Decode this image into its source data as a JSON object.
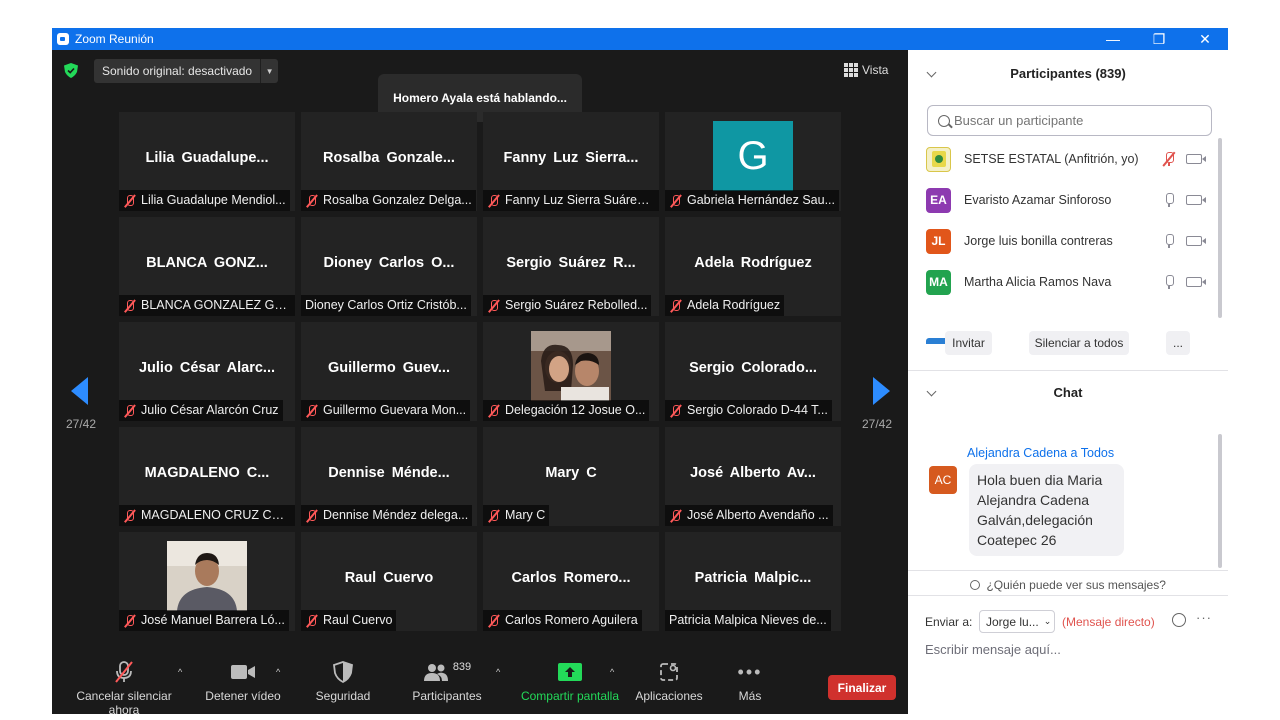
{
  "window": {
    "title": "Zoom Reunión",
    "minimize_icon": "minimize-icon",
    "restore_icon": "restore-icon",
    "close_icon": "close-icon"
  },
  "meeting": {
    "sound_label": "Sonido original: desactivado",
    "speaking_banner": "Homero Ayala está hablando...",
    "view_label": "Vista",
    "page_left": "27/42",
    "page_right": "27/42",
    "tiles": [
      {
        "big": "Lilia  Guadalupe...",
        "caption": "Lilia Guadalupe Mendiol...",
        "muted": true
      },
      {
        "big": "Rosalba  Gonzale...",
        "caption": "Rosalba Gonzalez Delga...",
        "muted": true
      },
      {
        "big": "Fanny Luz Sierra...",
        "caption": "Fanny Luz Sierra Suárez ...",
        "muted": true
      },
      {
        "big": "",
        "caption": "Gabriela Hernández Sau...",
        "muted": true,
        "avatar_letter": "G"
      },
      {
        "big": "BLANCA  GONZ...",
        "caption": "BLANCA GONZALEZ GA...",
        "muted": true
      },
      {
        "big": "Dioney Carlos  O...",
        "caption": "Dioney Carlos Ortiz Cristób...",
        "muted": false
      },
      {
        "big": "Sergio  Suárez  R...",
        "caption": "Sergio Suárez Rebolled...",
        "muted": true
      },
      {
        "big": "Adela Rodríguez",
        "caption": "Adela Rodríguez",
        "muted": true
      },
      {
        "big": "Julio César Alarc...",
        "caption": "Julio César Alarcón Cruz",
        "muted": true
      },
      {
        "big": "Guillermo  Guev...",
        "caption": "Guillermo Guevara Mon...",
        "muted": true
      },
      {
        "big": "",
        "caption": "Delegación 12 Josue O...",
        "muted": true,
        "photo": "couple"
      },
      {
        "big": "Sergio  Colorado...",
        "caption": "Sergio Colorado D-44 T...",
        "muted": true
      },
      {
        "big": "MAGDALENO C...",
        "caption": "MAGDALENO CRUZ CAS...",
        "muted": true
      },
      {
        "big": "Dennise  Ménde...",
        "caption": "Dennise Méndez delega...",
        "muted": true
      },
      {
        "big": "Mary C",
        "caption": "Mary C",
        "muted": true
      },
      {
        "big": "José Alberto Av...",
        "caption": "José Alberto Avendaño ...",
        "muted": true
      },
      {
        "big": "",
        "caption": "José Manuel Barrera Ló...",
        "muted": true,
        "photo": "man"
      },
      {
        "big": "Raul Cuervo",
        "caption": "Raul Cuervo",
        "muted": true
      },
      {
        "big": "Carlos  Romero...",
        "caption": "Carlos Romero Aguilera",
        "muted": true
      },
      {
        "big": "Patricia   Malpic...",
        "caption": "Patricia  Malpica Nieves de...",
        "muted": false
      }
    ]
  },
  "toolbar": {
    "unmute": "Cancelar silenciar ahora",
    "stop_video": "Detener vídeo",
    "security": "Seguridad",
    "participants": "Participantes",
    "participants_count": "839",
    "share": "Compartir pantalla",
    "apps": "Aplicaciones",
    "more": "Más",
    "end": "Finalizar"
  },
  "colors": {
    "accent": "#0e71eb",
    "share_green": "#23d959",
    "end_red": "#d0312d",
    "mute_red": "#ff5959"
  },
  "participants": {
    "title": "Participantes (839)",
    "search_placeholder": "Buscar un participante",
    "list": [
      {
        "initials": "",
        "name": "SETSE ESTATAL (Anfitrión, yo)",
        "color": "#e8d84a",
        "mic": "muted"
      },
      {
        "initials": "EA",
        "name": "Evaristo Azamar Sinforoso",
        "color": "#8d3ab0",
        "mic": "on"
      },
      {
        "initials": "JL",
        "name": "Jorge luis bonilla contreras",
        "color": "#e1561a",
        "mic": "on"
      },
      {
        "initials": "MA",
        "name": "Martha Alicia Ramos Nava",
        "color": "#22a34f",
        "mic": "on"
      }
    ],
    "invite": "Invitar",
    "mute_all": "Silenciar a todos",
    "more": "..."
  },
  "chat": {
    "title": "Chat",
    "sender": "Alejandra Cadena a Todos",
    "sender_initials": "AC",
    "message": "Hola buen dia Maria Alejandra Cadena Galván,delegación Coatepec 26",
    "who_can_see": "¿Quién puede ver sus mensajes?",
    "send_to_label": "Enviar a:",
    "send_to_value": "Jorge lu...",
    "direct_message": "(Mensaje directo)",
    "input_placeholder": "Escribir mensaje aquí..."
  }
}
